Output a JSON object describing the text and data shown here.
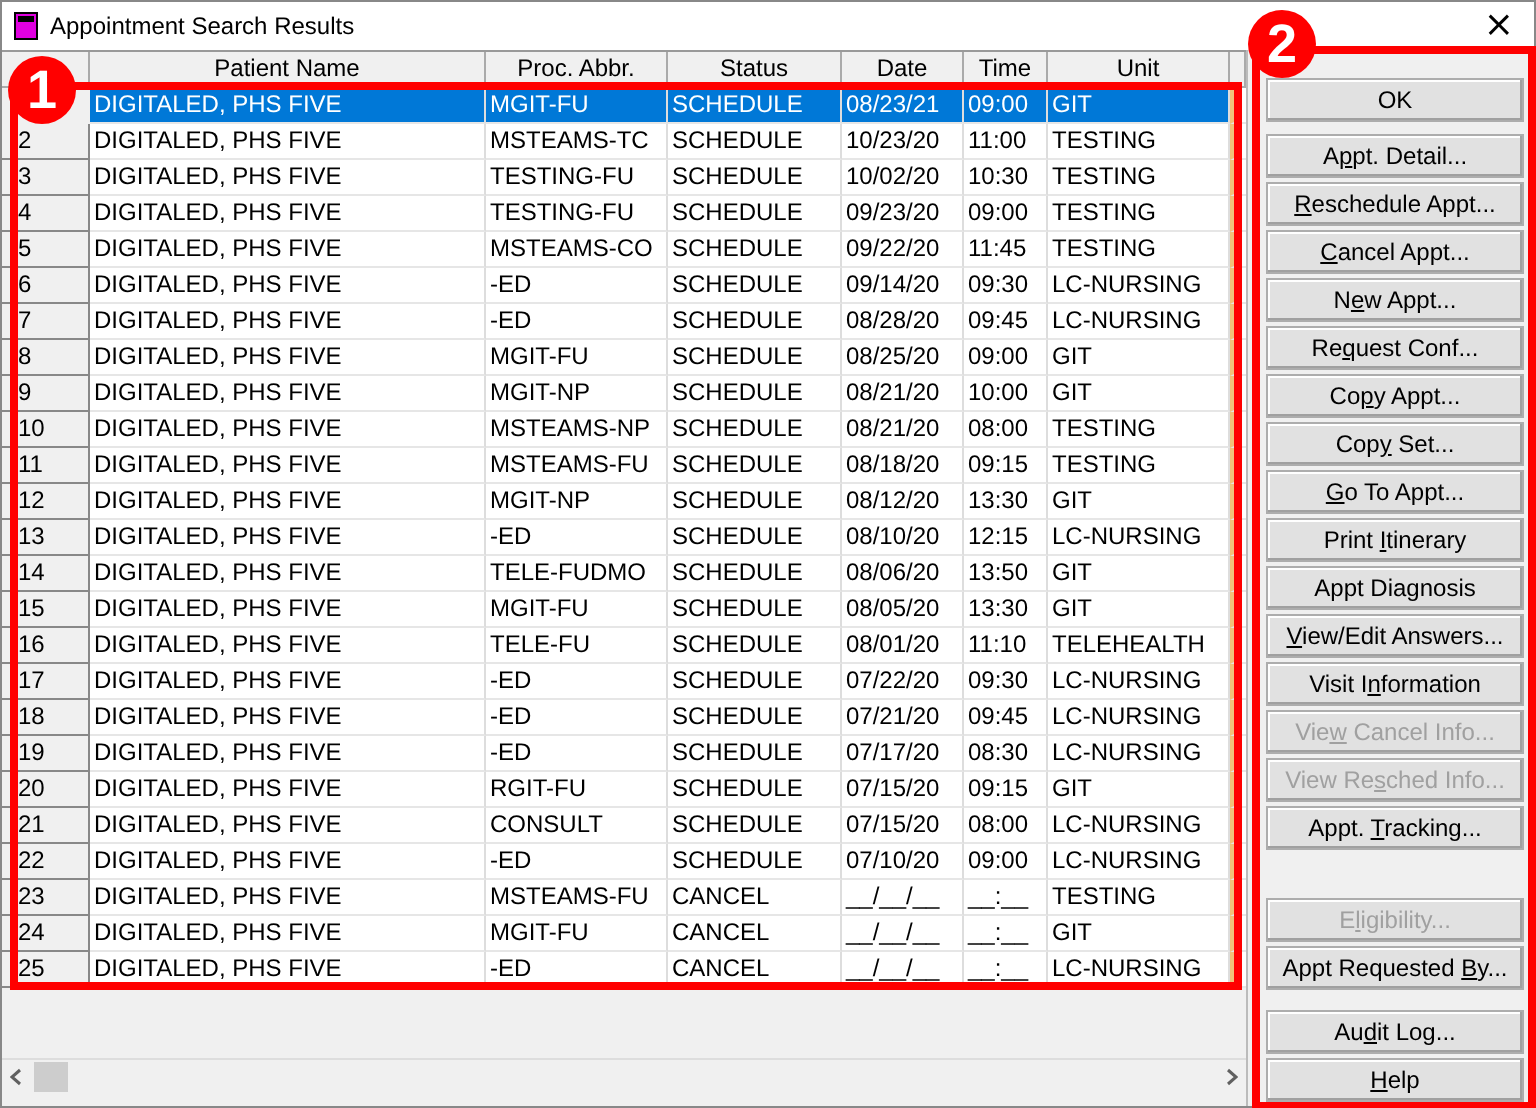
{
  "window": {
    "title": "Appointment Search Results",
    "close": "×"
  },
  "table": {
    "columns": [
      "",
      "Patient Name",
      "Proc. Abbr.",
      "Status",
      "Date",
      "Time",
      "Unit"
    ],
    "rows": [
      {
        "name": "DIGITALED, PHS FIVE",
        "proc": "MGIT-FU",
        "status": "SCHEDULE",
        "date": "08/23/21",
        "time": "09:00",
        "unit": "GIT",
        "selected": true
      },
      {
        "num": "2",
        "name": "DIGITALED, PHS FIVE",
        "proc": "MSTEAMS-TC",
        "status": "SCHEDULE",
        "date": "10/23/20",
        "time": "11:00",
        "unit": "TESTING",
        "selected": false
      },
      {
        "num": "3",
        "name": "DIGITALED, PHS FIVE",
        "proc": "TESTING-FU",
        "status": "SCHEDULE",
        "date": "10/02/20",
        "time": "10:30",
        "unit": "TESTING",
        "selected": false
      },
      {
        "num": "4",
        "name": "DIGITALED, PHS FIVE",
        "proc": "TESTING-FU",
        "status": "SCHEDULE",
        "date": "09/23/20",
        "time": "09:00",
        "unit": "TESTING",
        "selected": false
      },
      {
        "num": "5",
        "name": "DIGITALED, PHS FIVE",
        "proc": "MSTEAMS-CO",
        "status": "SCHEDULE",
        "date": "09/22/20",
        "time": "11:45",
        "unit": "TESTING",
        "selected": false
      },
      {
        "num": "6",
        "name": "DIGITALED, PHS FIVE",
        "proc": "-ED",
        "status": "SCHEDULE",
        "date": "09/14/20",
        "time": "09:30",
        "unit": "LC-NURSING",
        "selected": false
      },
      {
        "num": "7",
        "name": "DIGITALED, PHS FIVE",
        "proc": "-ED",
        "status": "SCHEDULE",
        "date": "08/28/20",
        "time": "09:45",
        "unit": "LC-NURSING",
        "selected": false
      },
      {
        "num": "8",
        "name": "DIGITALED, PHS FIVE",
        "proc": "MGIT-FU",
        "status": "SCHEDULE",
        "date": "08/25/20",
        "time": "09:00",
        "unit": "GIT",
        "selected": false
      },
      {
        "num": "9",
        "name": "DIGITALED, PHS FIVE",
        "proc": "MGIT-NP",
        "status": "SCHEDULE",
        "date": "08/21/20",
        "time": "10:00",
        "unit": "GIT",
        "selected": false
      },
      {
        "num": "10",
        "name": "DIGITALED, PHS FIVE",
        "proc": "MSTEAMS-NP",
        "status": "SCHEDULE",
        "date": "08/21/20",
        "time": "08:00",
        "unit": "TESTING",
        "selected": false
      },
      {
        "num": "11",
        "name": "DIGITALED, PHS FIVE",
        "proc": "MSTEAMS-FU",
        "status": "SCHEDULE",
        "date": "08/18/20",
        "time": "09:15",
        "unit": "TESTING",
        "selected": false
      },
      {
        "num": "12",
        "name": "DIGITALED, PHS FIVE",
        "proc": "MGIT-NP",
        "status": "SCHEDULE",
        "date": "08/12/20",
        "time": "13:30",
        "unit": "GIT",
        "selected": false
      },
      {
        "num": "13",
        "name": "DIGITALED, PHS FIVE",
        "proc": "-ED",
        "status": "SCHEDULE",
        "date": "08/10/20",
        "time": "12:15",
        "unit": "LC-NURSING",
        "selected": false
      },
      {
        "num": "14",
        "name": "DIGITALED, PHS FIVE",
        "proc": "TELE-FUDMO",
        "status": "SCHEDULE",
        "date": "08/06/20",
        "time": "13:50",
        "unit": "GIT",
        "selected": false
      },
      {
        "num": "15",
        "name": "DIGITALED, PHS FIVE",
        "proc": "MGIT-FU",
        "status": "SCHEDULE",
        "date": "08/05/20",
        "time": "13:30",
        "unit": "GIT",
        "selected": false
      },
      {
        "num": "16",
        "name": "DIGITALED, PHS FIVE",
        "proc": "TELE-FU",
        "status": "SCHEDULE",
        "date": "08/01/20",
        "time": "11:10",
        "unit": "TELEHEALTH",
        "selected": false
      },
      {
        "num": "17",
        "name": "DIGITALED, PHS FIVE",
        "proc": "-ED",
        "status": "SCHEDULE",
        "date": "07/22/20",
        "time": "09:30",
        "unit": "LC-NURSING",
        "selected": false
      },
      {
        "num": "18",
        "name": "DIGITALED, PHS FIVE",
        "proc": "-ED",
        "status": "SCHEDULE",
        "date": "07/21/20",
        "time": "09:45",
        "unit": "LC-NURSING",
        "selected": false
      },
      {
        "num": "19",
        "name": "DIGITALED, PHS FIVE",
        "proc": "-ED",
        "status": "SCHEDULE",
        "date": "07/17/20",
        "time": "08:30",
        "unit": "LC-NURSING",
        "selected": false
      },
      {
        "num": "20",
        "name": "DIGITALED, PHS FIVE",
        "proc": "RGIT-FU",
        "status": "SCHEDULE",
        "date": "07/15/20",
        "time": "09:15",
        "unit": "GIT",
        "selected": false
      },
      {
        "num": "21",
        "name": "DIGITALED, PHS FIVE",
        "proc": "CONSULT",
        "status": "SCHEDULE",
        "date": "07/15/20",
        "time": "08:00",
        "unit": "LC-NURSING",
        "selected": false
      },
      {
        "num": "22",
        "name": "DIGITALED, PHS FIVE",
        "proc": "-ED",
        "status": "SCHEDULE",
        "date": "07/10/20",
        "time": "09:00",
        "unit": "LC-NURSING",
        "selected": false
      },
      {
        "num": "23",
        "name": "DIGITALED, PHS FIVE",
        "proc": "MSTEAMS-FU",
        "status": "CANCEL",
        "date": "__/__/__",
        "time": "__:__",
        "unit": "TESTING",
        "selected": false
      },
      {
        "num": "24",
        "name": "DIGITALED, PHS FIVE",
        "proc": "MGIT-FU",
        "status": "CANCEL",
        "date": "__/__/__",
        "time": "__:__",
        "unit": "GIT",
        "selected": false
      },
      {
        "num": "25",
        "name": "DIGITALED, PHS FIVE",
        "proc": "-ED",
        "status": "CANCEL",
        "date": "__/__/__",
        "time": "__:__",
        "unit": "LC-NURSING",
        "selected": false
      }
    ]
  },
  "button_groups": [
    [
      {
        "label": {
          "post": "OK"
        },
        "disabled": false
      }
    ],
    [
      {
        "label": {
          "pre": "A",
          "key": "p",
          "post": "pt. Detail..."
        },
        "disabled": false
      },
      {
        "label": {
          "key": "R",
          "post": "eschedule Appt..."
        },
        "disabled": false
      },
      {
        "label": {
          "key": "C",
          "post": "ancel Appt..."
        },
        "disabled": false
      },
      {
        "label": {
          "pre": "N",
          "key": "e",
          "post": "w Appt..."
        },
        "disabled": false
      },
      {
        "label": {
          "pre": "Re",
          "key": "q",
          "post": "uest Conf..."
        },
        "disabled": false
      },
      {
        "label": {
          "pre": "Co",
          "key": "p",
          "post": "y Appt..."
        },
        "disabled": false
      },
      {
        "label": {
          "pre": "Cop",
          "key": "y",
          "post": " Set..."
        },
        "disabled": false
      },
      {
        "label": {
          "key": "G",
          "post": "o To Appt..."
        },
        "disabled": false
      },
      {
        "label": {
          "pre": "Print ",
          "key": "I",
          "post": "tinerary"
        },
        "disabled": false
      },
      {
        "label": {
          "post": "Appt Diagnosis"
        },
        "disabled": false
      },
      {
        "label": {
          "key": "V",
          "post": "iew/Edit Answers..."
        },
        "disabled": false
      },
      {
        "label": {
          "pre": "Visit I",
          "key": "n",
          "post": "formation"
        },
        "disabled": false
      },
      {
        "label": {
          "pre": "Vie",
          "key": "w",
          "post": " Cancel Info..."
        },
        "disabled": true
      },
      {
        "label": {
          "pre": "View Re",
          "key": "s",
          "post": "ched Info..."
        },
        "disabled": true
      },
      {
        "label": {
          "pre": "Appt. ",
          "key": "T",
          "post": "racking..."
        },
        "disabled": false
      }
    ],
    [
      {
        "label": {
          "pre": "E",
          "key": "l",
          "post": "igibility..."
        },
        "disabled": true
      },
      {
        "label": {
          "pre": "Appt Requested ",
          "key": "B",
          "post": "y..."
        },
        "disabled": false
      }
    ],
    [
      {
        "label": {
          "pre": "Au",
          "key": "d",
          "post": "it Log..."
        },
        "disabled": false
      },
      {
        "label": {
          "key": "H",
          "post": "elp"
        },
        "disabled": false
      }
    ]
  ],
  "annotations": [
    {
      "label": "1"
    },
    {
      "label": "2"
    }
  ]
}
